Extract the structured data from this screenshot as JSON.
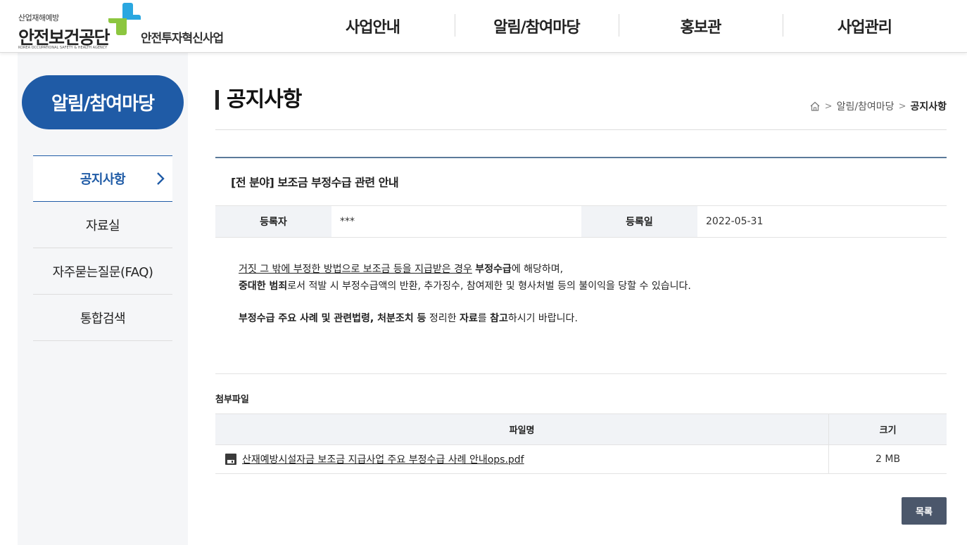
{
  "logo": {
    "sub": "산업재해예방",
    "main": "안전보건공단",
    "eng": "KOREA OCCUPATIONAL SAFETY & HEALTH AGENCY",
    "project": "안전투자혁신사업",
    "cross_colors": [
      "#2aa7e0",
      "#8cc63f"
    ]
  },
  "gnb": [
    "사업안내",
    "알림/참여마당",
    "홍보관",
    "사업관리"
  ],
  "sidebar": {
    "title": "알림/참여마당",
    "items": [
      "공지사항",
      "자료실",
      "자주묻는질문(FAQ)",
      "통합검색"
    ],
    "active_index": 0
  },
  "page": {
    "title": "공지사항",
    "breadcrumb": [
      "알림/참여마당",
      "공지사항"
    ]
  },
  "post": {
    "subject": "[전 분야] 보조금 부정수급 관련 안내",
    "author_label": "등록자",
    "author": "***",
    "date_label": "등록일",
    "date": "2022-05-31",
    "body": {
      "l1_u": "거짓 그 밖에 부정한 방법으로 보조금 등을 지급받은 경우",
      "l1_sp": " ",
      "l1_b": "부정수급",
      "l1_t": "에 해당하며,",
      "l2_b": "중대한 범죄",
      "l2_t": "로서 적발 시 부정수급액의 반환, 추가징수, 참여제한 및 형사처벌 등의 불이익을 당할 수 있습니다.",
      "l3_b1": "부정수급 주요 사례 및 관련법령, 처분조치 등",
      "l3_t1": " 정리한 ",
      "l3_b2": "자료",
      "l3_t2": "를 ",
      "l3_b3": "참고",
      "l3_t3": "하시기 바랍니다."
    }
  },
  "attachments": {
    "title": "첨부파일",
    "col_name": "파일명",
    "col_size": "크기",
    "files": [
      {
        "name": "산재예방시설자금 보조금 지급사업 주요 부정수급 사례 안내ops.pdf",
        "size": "2 MB"
      }
    ]
  },
  "buttons": {
    "list": "목록"
  },
  "colors": {
    "primary": "#1f5ba6",
    "button": "#4b576b",
    "table_head": "#f1f3f6"
  }
}
